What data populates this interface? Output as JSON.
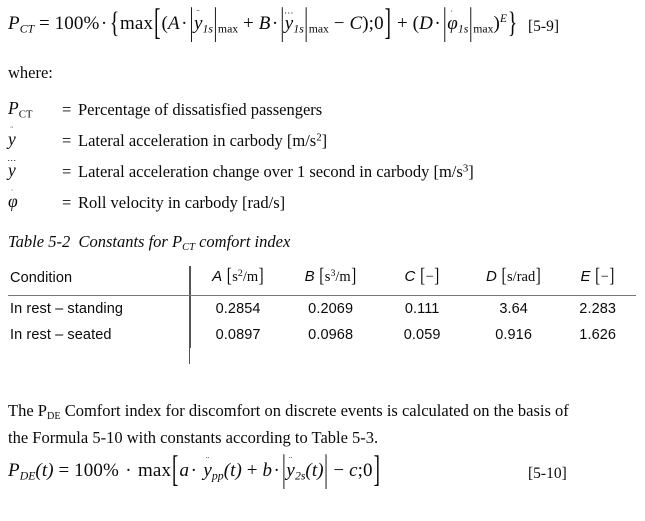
{
  "equation_5_9": {
    "label": "[5-9]",
    "lhs_symbol": "P",
    "lhs_subscript": "CT",
    "percent": "100%",
    "max_operator": "max",
    "const_A": "A",
    "const_B": "B",
    "const_C": "C",
    "const_D": "D",
    "exponent_E": "E",
    "zero": "0",
    "accel_symbol": "y",
    "accel_subscript": "1s",
    "accel_limit": "max",
    "jerk_symbol": "y",
    "jerk_subscript": "1s",
    "jerk_limit": "max",
    "roll_symbol": "φ",
    "roll_subscript": "1s",
    "roll_limit": "max",
    "plain_text": "P_CT = 100% · { max[ (A·|ÿ_1s|_max + B·|y⃛_1s|_max − C);0 ] + (D·|φ̇_1s|_max)^E }"
  },
  "where_label": "where:",
  "definitions": [
    {
      "symbol_base": "P",
      "symbol_subscript": "CT",
      "symbol_kind": "P-subscript",
      "equals": "=",
      "text": "Percentage of dissatisfied passengers",
      "unit_exponent": ""
    },
    {
      "symbol_base": "y",
      "symbol_accent": "¨",
      "symbol_kind": "y-double-dot",
      "equals": "=",
      "text": "Lateral acceleration in carbody [m/s",
      "unit_exponent": "2",
      "text_tail": "]"
    },
    {
      "symbol_base": "y",
      "symbol_accent": "ⵣ",
      "symbol_kind": "y-triple-dot",
      "equals": "=",
      "text": "Lateral acceleration change over 1 second in carbody [m/s",
      "unit_exponent": "3",
      "text_tail": "]"
    },
    {
      "symbol_base": "φ",
      "symbol_accent": "˙",
      "symbol_kind": "phi-dot",
      "equals": "=",
      "text": "Roll velocity in carbody [rad/s]",
      "unit_exponent": "",
      "text_tail": ""
    }
  ],
  "table": {
    "caption_prefix": "Table 5-2",
    "caption_text_a": "Constants for P",
    "caption_subscript": "CT",
    "caption_text_b": "comfort index",
    "columns": [
      {
        "label": "Condition",
        "unit": "",
        "unit_num": "",
        "unit_den": "",
        "type": "text"
      },
      {
        "label": "A",
        "unit_num": "s",
        "unit_num_sup": "2",
        "unit_den": "m",
        "type": "frac"
      },
      {
        "label": "B",
        "unit_num": "s",
        "unit_num_sup": "3",
        "unit_den": "m",
        "type": "frac"
      },
      {
        "label": "C",
        "unit_plain": "−",
        "type": "dash"
      },
      {
        "label": "D",
        "unit_plain": "s/rad",
        "type": "plain"
      },
      {
        "label": "E",
        "unit_plain": "−",
        "type": "dash"
      }
    ],
    "rows": [
      {
        "condition": "In rest – standing",
        "A": "0.2854",
        "B": "0.2069",
        "C": "0.111",
        "D": "3.64",
        "E": "2.283"
      },
      {
        "condition": "In rest – seated",
        "A": "0.0897",
        "B": "0.0968",
        "C": "0.059",
        "D": "0.916",
        "E": "1.626"
      }
    ]
  },
  "paragraph": {
    "line1_a": "The P",
    "line1_sub": "DE",
    "line1_b": " Comfort index for discomfort on discrete events is calculated on the basis of",
    "line2": "the Formula 5-10 with constants according to Table 5-3."
  },
  "equation_5_10": {
    "label": "[5-10]",
    "lhs_symbol": "P",
    "lhs_subscript": "DE",
    "lhs_arg": "(t)",
    "percent": "100%",
    "max_operator": "max",
    "const_a": "a",
    "const_b": "b",
    "const_c": "c",
    "zero": "0",
    "accel_pp_symbol": "y",
    "accel_pp_subscript": "pp",
    "accel_2s_symbol": "y",
    "accel_2s_subscript": "2s",
    "plain_text": "P_DE(t) = 100% · max[ a·ÿ_pp(t) + b·|ÿ_2s(t)| − c;0 ]"
  },
  "colors": {
    "text": "#0a0a0a",
    "rule": "#555555",
    "page_background": "#ffffff"
  }
}
